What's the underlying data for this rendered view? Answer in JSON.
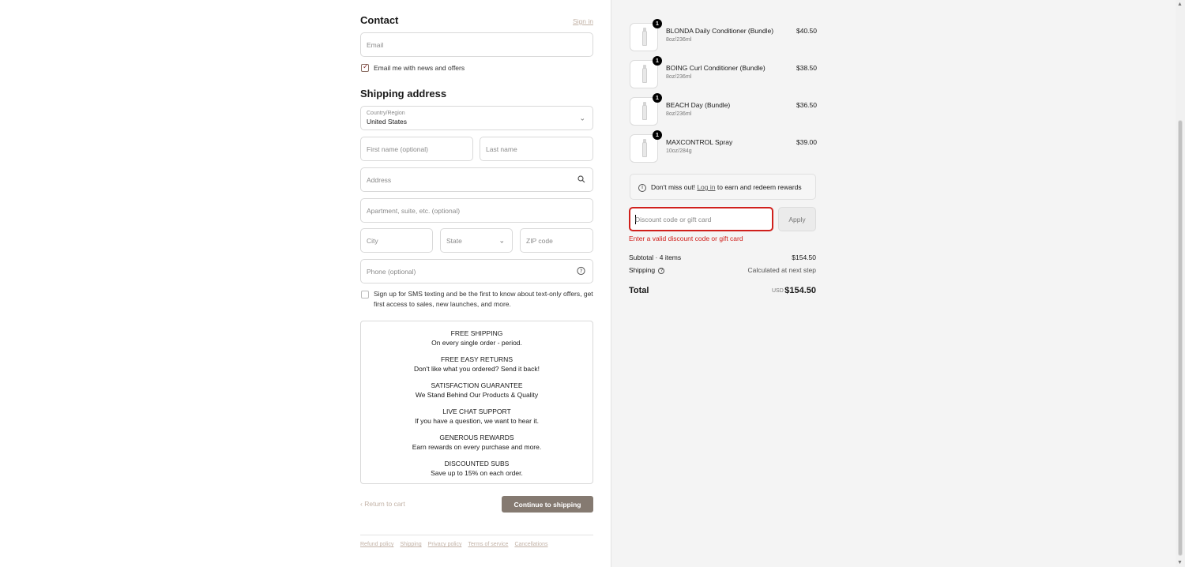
{
  "contact": {
    "heading": "Contact",
    "sign_in": "Sign in",
    "email_placeholder": "Email",
    "newsletter_label": "Email me with news and offers",
    "newsletter_checked": true
  },
  "shipping": {
    "heading": "Shipping address",
    "country_label": "Country/Region",
    "country_value": "United States",
    "first_name_placeholder": "First name (optional)",
    "last_name_placeholder": "Last name",
    "address_placeholder": "Address",
    "apartment_placeholder": "Apartment, suite, etc. (optional)",
    "city_placeholder": "City",
    "state_placeholder": "State",
    "zip_placeholder": "ZIP code",
    "phone_placeholder": "Phone (optional)",
    "sms_line1": "Sign up for SMS texting and be the first to know about text-only offers, get",
    "sms_line2": "first access to sales, new launches, and more."
  },
  "benefits": [
    {
      "title": "FREE SHIPPING",
      "text": "On every single order - period."
    },
    {
      "title": "FREE EASY RETURNS",
      "text": "Don't like what you ordered? Send it back!"
    },
    {
      "title": "SATISFACTION GUARANTEE",
      "text": "We Stand Behind Our Products & Quality"
    },
    {
      "title": "LIVE CHAT SUPPORT",
      "text": "If you have a question, we want to hear it."
    },
    {
      "title": "GENEROUS REWARDS",
      "text": "Earn rewards on every purchase and more."
    },
    {
      "title": "DISCOUNTED SUBS",
      "text": "Save up to 15% on each order."
    }
  ],
  "actions": {
    "return_to_cart": "Return to cart",
    "continue": "Continue to shipping"
  },
  "footer_links": [
    "Refund policy",
    "Shipping",
    "Privacy policy",
    "Terms of service",
    "Cancellations"
  ],
  "cart": {
    "items": [
      {
        "qty": "1",
        "name": "BLONDA Daily Conditioner (Bundle)",
        "size": "8oz/236ml",
        "price": "$40.50"
      },
      {
        "qty": "1",
        "name": "BOING Curl Conditioner (Bundle)",
        "size": "8oz/236ml",
        "price": "$38.50"
      },
      {
        "qty": "1",
        "name": "BEACH Day (Bundle)",
        "size": "8oz/236ml",
        "price": "$36.50"
      },
      {
        "qty": "1",
        "name": "MAXCONTROL Spray",
        "size": "10oz/284g",
        "price": "$39.00"
      }
    ],
    "rewards_prefix": "Don't miss out!",
    "rewards_link": "Log in",
    "rewards_suffix": "to earn and redeem rewards",
    "discount_placeholder": "Discount code or gift card",
    "apply_label": "Apply",
    "discount_error": "Enter a valid discount code or gift card",
    "subtotal_label": "Subtotal · 4 items",
    "subtotal_value": "$154.50",
    "shipping_label": "Shipping",
    "shipping_value": "Calculated at next step",
    "total_label": "Total",
    "currency": "USD",
    "total_value": "$154.50"
  },
  "colors": {
    "primary_button": "#857a71",
    "error": "#d0201c",
    "muted_link": "#c2b2a6"
  }
}
